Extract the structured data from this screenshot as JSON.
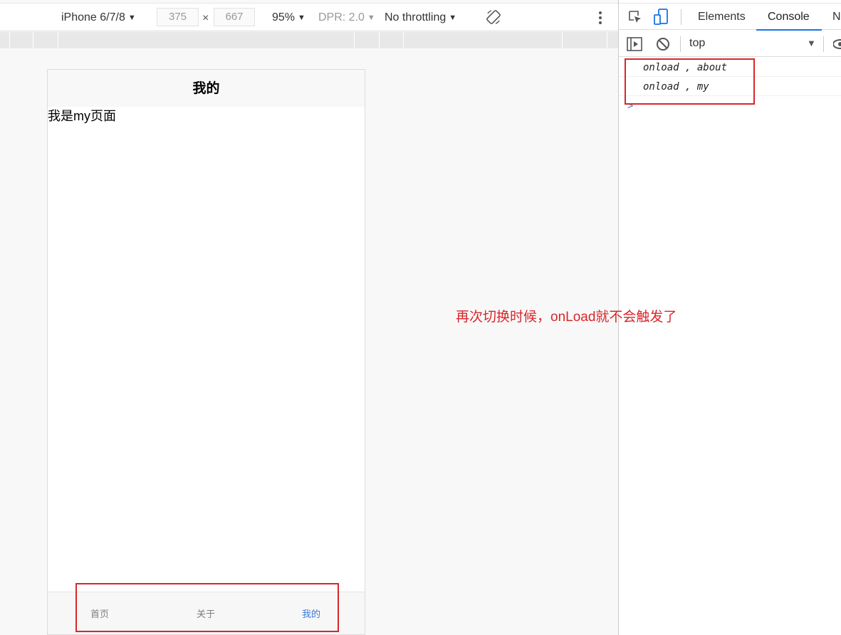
{
  "emulation": {
    "device": "iPhone 6/7/8",
    "width": "375",
    "height": "667",
    "times": "×",
    "zoom": "95%",
    "dpr": "DPR: 2.0",
    "throttle": "No throttling"
  },
  "phone": {
    "nav_title": "我的",
    "page_text": "我是my页面",
    "tabs": [
      {
        "label": "首页",
        "active": false
      },
      {
        "label": "关于",
        "active": false
      },
      {
        "label": "我的",
        "active": true
      }
    ]
  },
  "devtools": {
    "tabs": [
      "Elements",
      "Console",
      "N"
    ],
    "active_tab": "Console",
    "context": "top",
    "logs": [
      "onload , about",
      "onload , my"
    ],
    "prompt": ">"
  },
  "annotation": {
    "note": "再次切换时候，onLoad就不会触发了"
  },
  "colors": {
    "annotation_red": "#d9262a",
    "active_tab_blue": "#3a7bd5",
    "devtools_accent": "#1a73e8"
  }
}
